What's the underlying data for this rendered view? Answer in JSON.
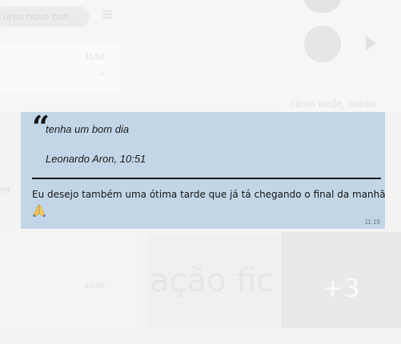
{
  "background": {
    "search_text": "ursa nove con…",
    "times": [
      "11:50",
      "10:08"
    ],
    "faded_text": "ótima tarde, outros",
    "side_stub": "ent",
    "big_word": "ação fic",
    "more_photos": "+3"
  },
  "message": {
    "quote": {
      "text": "tenha um bom dia",
      "author": "Leonardo Aron, 10:51"
    },
    "body": "Eu desejo também uma ótima tarde que já tá chegando o final da manhã",
    "emoji": "folded-hands-emoji",
    "time": "11:19"
  },
  "colors": {
    "bubble": "#c3d6e8",
    "backdrop": "#f3f3f3"
  }
}
